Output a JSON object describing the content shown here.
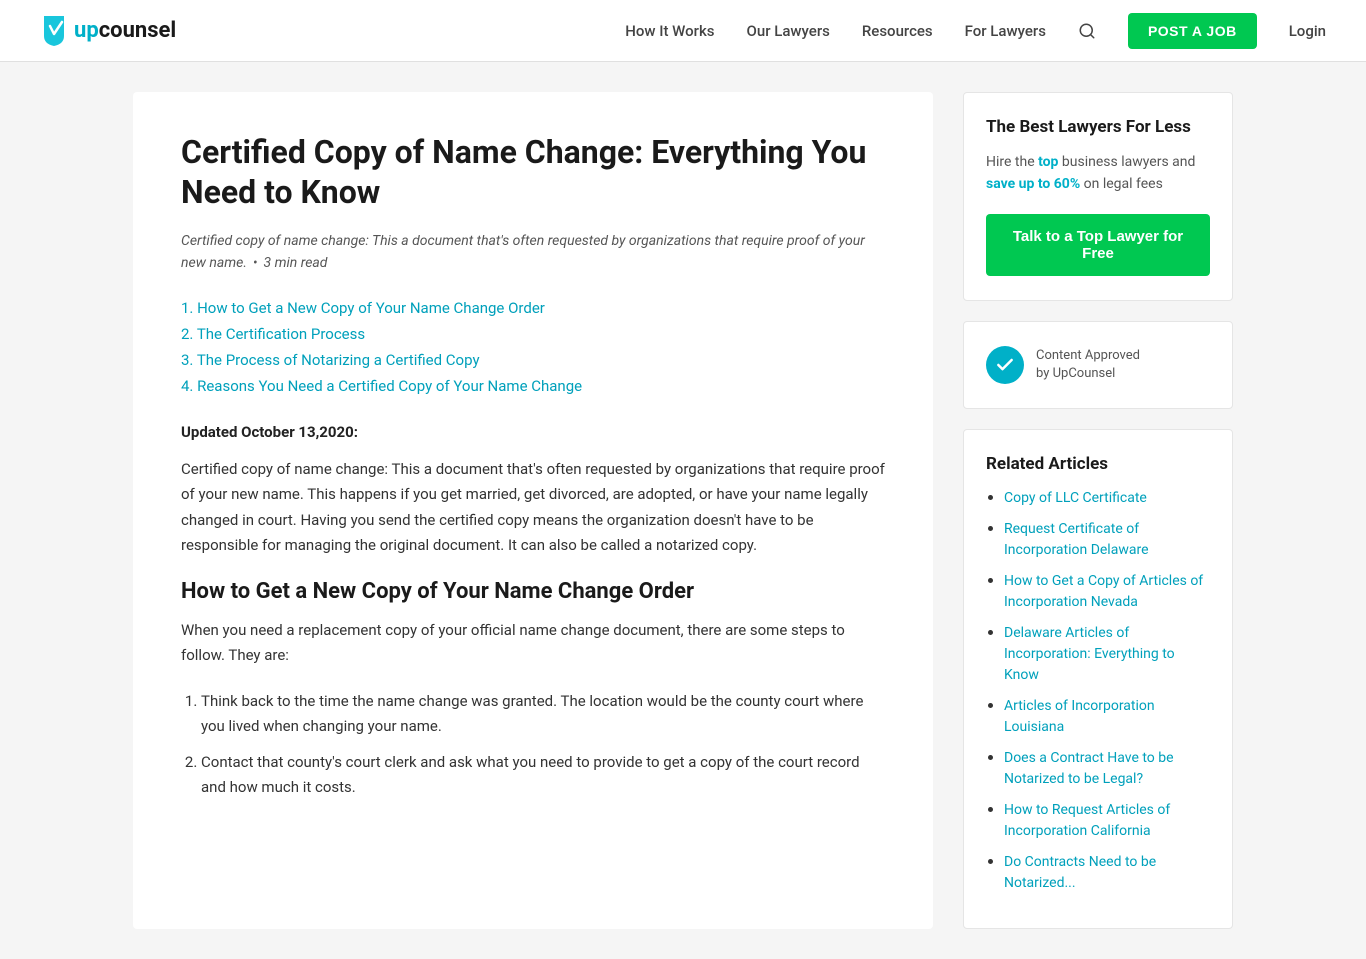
{
  "nav": {
    "logo_text": "upcounsel",
    "links": [
      {
        "id": "how-it-works",
        "label": "How It Works"
      },
      {
        "id": "our-lawyers",
        "label": "Our Lawyers"
      },
      {
        "id": "resources",
        "label": "Resources"
      },
      {
        "id": "for-lawyers",
        "label": "For Lawyers"
      }
    ],
    "post_job_label": "POST A JOB",
    "login_label": "Login"
  },
  "article": {
    "title": "Certified Copy of Name Change: Everything You Need to Know",
    "subtitle": "Certified copy of name change: This a document that's often requested by organizations that require proof of your new name.",
    "read_time": "3 min read",
    "toc": [
      {
        "num": "1",
        "label": "How to Get a New Copy of Your Name Change Order"
      },
      {
        "num": "2",
        "label": "The Certification Process"
      },
      {
        "num": "3",
        "label": "The Process of Notarizing a Certified Copy"
      },
      {
        "num": "4",
        "label": "Reasons You Need a Certified Copy of Your Name Change"
      }
    ],
    "updated": "Updated October 13,2020:",
    "body1": "Certified copy of name change: This a document that's often requested by organizations that require proof of your new name. This happens if you get married, get divorced, are adopted, or have your name legally changed in court. Having you send the certified copy means the organization doesn't have to be responsible for managing the original document. It can also be called a notarized copy.",
    "section1_heading": "How to Get a New Copy of Your Name Change Order",
    "section1_intro": "When you need a replacement copy of your official name change document, there are some steps to follow. They are:",
    "steps": [
      "Think back to the time the name change was granted. The location would be the county court where you lived when changing your name.",
      "Contact that county's court clerk and ask what you need to provide to get a copy of the court record and how much it costs."
    ]
  },
  "sidebar": {
    "best_lawyers": {
      "title": "The Best Lawyers For Less",
      "hire_text_before": "Hire the ",
      "hire_bold1": "top",
      "hire_text_mid": " business lawyers and ",
      "hire_bold2": "save up to 60%",
      "hire_text_after": " on legal fees",
      "cta_label": "Talk to a Top Lawyer for Free"
    },
    "approved": {
      "line1": "Content Approved",
      "line2": "by UpCounsel"
    },
    "related_title": "Related Articles",
    "related_links": [
      {
        "label": "Copy of LLC Certificate"
      },
      {
        "label": "Request Certificate of Incorporation Delaware"
      },
      {
        "label": "How to Get a Copy of Articles of Incorporation Nevada"
      },
      {
        "label": "Delaware Articles of Incorporation: Everything to Know"
      },
      {
        "label": "Articles of Incorporation Louisiana"
      },
      {
        "label": "Does a Contract Have to be Notarized to be Legal?"
      },
      {
        "label": "How to Request Articles of Incorporation California"
      },
      {
        "label": "Do Contracts Need to be Notarized..."
      }
    ]
  }
}
